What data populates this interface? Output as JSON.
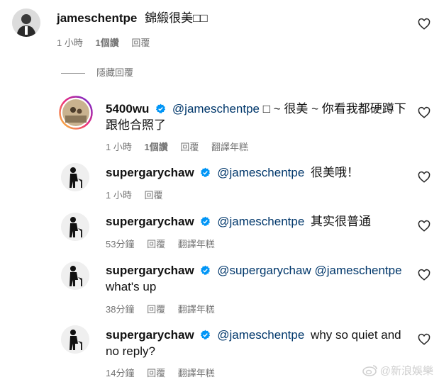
{
  "comments": [
    {
      "user": "jameschentpe",
      "text": "錦緞很美□□",
      "meta": [
        "1 小時",
        "1個讚",
        "回覆"
      ]
    },
    {
      "hide_replies": "隱藏回覆"
    },
    {
      "user": "5400wu",
      "mention": "@jameschentpe",
      "text1": "□ ~ 很美 ~ 你看我都硬蹲下",
      "text2": "跟他合照了",
      "meta": [
        "1 小時",
        "1個讚",
        "回覆",
        "翻譯年糕"
      ]
    },
    {
      "user": "supergarychaw",
      "mention": "@jameschentpe",
      "text": "很美哦！",
      "meta": [
        "1 小時",
        "回覆"
      ]
    },
    {
      "user": "supergarychaw",
      "mention": "@jameschentpe",
      "text": "其实很普通",
      "meta": [
        "53分鐘",
        "回覆",
        "翻譯年糕"
      ]
    },
    {
      "user": "supergarychaw",
      "mention": "@supergarychaw @jameschentpe",
      "text2": "what's up",
      "meta": [
        "38分鐘",
        "回覆",
        "翻譯年糕"
      ]
    },
    {
      "user": "supergarychaw",
      "mention": "@jameschentpe",
      "text": "why so quiet and",
      "text2": "no reply?",
      "meta": [
        "14分鐘",
        "回覆",
        "翻譯年糕"
      ]
    }
  ],
  "watermark": "@新浪娛樂",
  "colors": {
    "mention": "#00376b",
    "meta": "#737373",
    "verified": "#0095f6"
  }
}
